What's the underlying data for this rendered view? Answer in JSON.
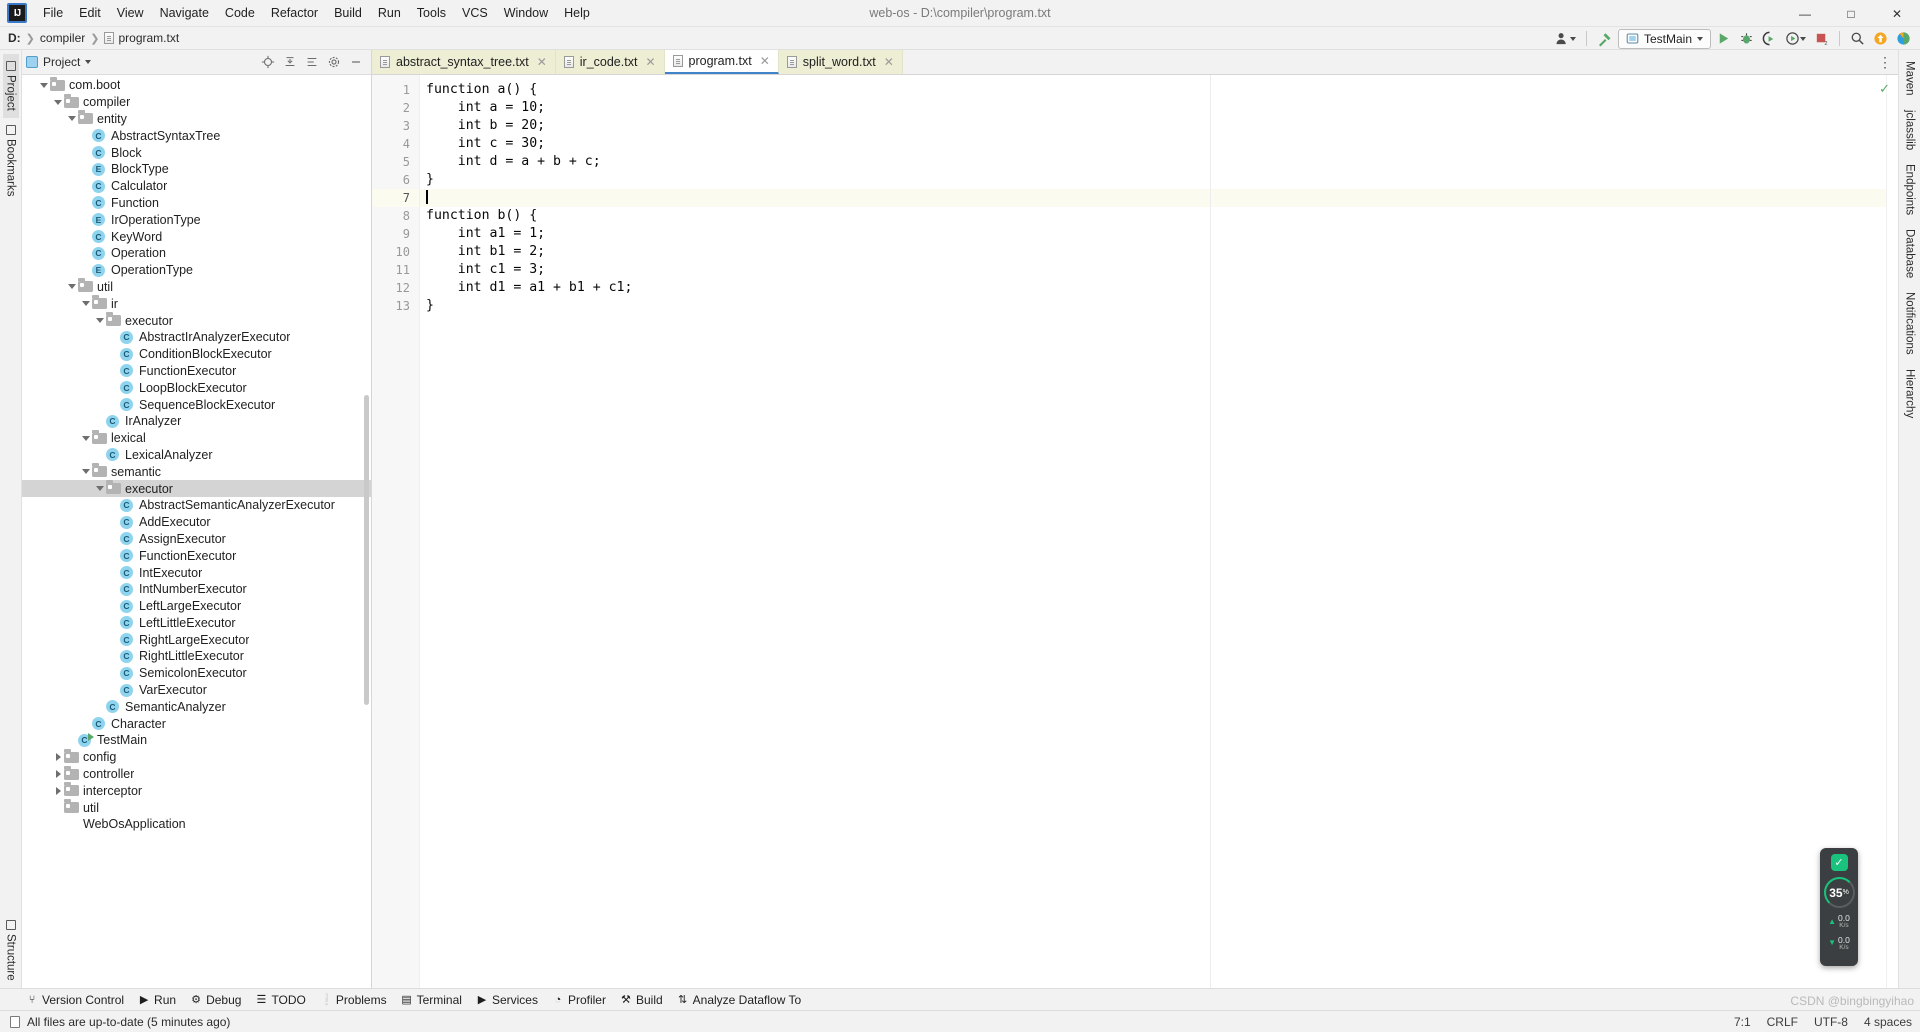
{
  "window": {
    "title": "web-os - D:\\compiler\\program.txt",
    "logo": "IJ",
    "minimize": "—",
    "maximize": "□",
    "close": "✕"
  },
  "menu": [
    "File",
    "Edit",
    "View",
    "Navigate",
    "Code",
    "Refactor",
    "Build",
    "Run",
    "Tools",
    "VCS",
    "Window",
    "Help"
  ],
  "breadcrumb": {
    "drive": "D:",
    "folder": "compiler",
    "file": "program.txt"
  },
  "toolbar": {
    "account_icon": "account-icon",
    "build_icon": "hammer-icon",
    "run_config": "TestMain",
    "run_icon": "run-icon",
    "debug_icon": "debug-icon",
    "run_coverage_icon": "run-with-coverage-icon",
    "profiler_icon": "profiler-icon",
    "stop_icon": "stop-icon",
    "search_icon": "search-icon",
    "update_icon": "update-icon",
    "ide_icon": "ide-icon"
  },
  "left_stripe": [
    {
      "label": "Project",
      "active": true
    },
    {
      "label": "Bookmarks",
      "active": false
    },
    {
      "label": "Structure",
      "active": false
    }
  ],
  "right_stripe": [
    {
      "label": "Maven"
    },
    {
      "label": "jclasslib"
    },
    {
      "label": "Endpoints"
    },
    {
      "label": "Database"
    },
    {
      "label": "Notifications"
    },
    {
      "label": "Hierarchy"
    }
  ],
  "project_panel": {
    "title": "Project",
    "dropdown_icon": "chevron-down-icon",
    "actions": [
      "locate-icon",
      "collapse-all-icon",
      "expand-icon",
      "settings-icon",
      "hide-icon"
    ],
    "tree": [
      {
        "depth": 3,
        "type": "folder",
        "label": "com.boot",
        "twisty": "open"
      },
      {
        "depth": 4,
        "type": "folder",
        "label": "compiler",
        "twisty": "open"
      },
      {
        "depth": 5,
        "type": "folder",
        "label": "entity",
        "twisty": "open"
      },
      {
        "depth": 6,
        "type": "class",
        "label": "AbstractSyntaxTree"
      },
      {
        "depth": 6,
        "type": "class",
        "label": "Block"
      },
      {
        "depth": 6,
        "type": "enum",
        "label": "BlockType"
      },
      {
        "depth": 6,
        "type": "class",
        "label": "Calculator"
      },
      {
        "depth": 6,
        "type": "class",
        "label": "Function"
      },
      {
        "depth": 6,
        "type": "enum",
        "label": "IrOperationType"
      },
      {
        "depth": 6,
        "type": "class",
        "label": "KeyWord"
      },
      {
        "depth": 6,
        "type": "class",
        "label": "Operation"
      },
      {
        "depth": 6,
        "type": "enum",
        "label": "OperationType"
      },
      {
        "depth": 5,
        "type": "folder",
        "label": "util",
        "twisty": "open"
      },
      {
        "depth": 6,
        "type": "folder",
        "label": "ir",
        "twisty": "open"
      },
      {
        "depth": 7,
        "type": "folder",
        "label": "executor",
        "twisty": "open"
      },
      {
        "depth": 8,
        "type": "class",
        "label": "AbstractIrAnalyzerExecutor"
      },
      {
        "depth": 8,
        "type": "class",
        "label": "ConditionBlockExecutor"
      },
      {
        "depth": 8,
        "type": "class",
        "label": "FunctionExecutor"
      },
      {
        "depth": 8,
        "type": "class",
        "label": "LoopBlockExecutor"
      },
      {
        "depth": 8,
        "type": "class",
        "label": "SequenceBlockExecutor"
      },
      {
        "depth": 7,
        "type": "class",
        "label": "IrAnalyzer"
      },
      {
        "depth": 6,
        "type": "folder",
        "label": "lexical",
        "twisty": "open"
      },
      {
        "depth": 7,
        "type": "class",
        "label": "LexicalAnalyzer"
      },
      {
        "depth": 6,
        "type": "folder",
        "label": "semantic",
        "twisty": "open"
      },
      {
        "depth": 7,
        "type": "folder",
        "label": "executor",
        "twisty": "open",
        "selected": true
      },
      {
        "depth": 8,
        "type": "class",
        "label": "AbstractSemanticAnalyzerExecutor"
      },
      {
        "depth": 8,
        "type": "class",
        "label": "AddExecutor"
      },
      {
        "depth": 8,
        "type": "class",
        "label": "AssignExecutor"
      },
      {
        "depth": 8,
        "type": "class",
        "label": "FunctionExecutor"
      },
      {
        "depth": 8,
        "type": "class",
        "label": "IntExecutor"
      },
      {
        "depth": 8,
        "type": "class",
        "label": "IntNumberExecutor"
      },
      {
        "depth": 8,
        "type": "class",
        "label": "LeftLargeExecutor"
      },
      {
        "depth": 8,
        "type": "class",
        "label": "LeftLittleExecutor"
      },
      {
        "depth": 8,
        "type": "class",
        "label": "RightLargeExecutor"
      },
      {
        "depth": 8,
        "type": "class",
        "label": "RightLittleExecutor"
      },
      {
        "depth": 8,
        "type": "class",
        "label": "SemicolonExecutor"
      },
      {
        "depth": 8,
        "type": "class",
        "label": "VarExecutor"
      },
      {
        "depth": 7,
        "type": "class",
        "label": "SemanticAnalyzer"
      },
      {
        "depth": 6,
        "type": "class",
        "label": "Character"
      },
      {
        "depth": 5,
        "type": "class-main",
        "label": "TestMain"
      },
      {
        "depth": 4,
        "type": "folder",
        "label": "config",
        "twisty": "closed"
      },
      {
        "depth": 4,
        "type": "folder",
        "label": "controller",
        "twisty": "closed"
      },
      {
        "depth": 4,
        "type": "folder",
        "label": "interceptor",
        "twisty": "closed"
      },
      {
        "depth": 4,
        "type": "folder",
        "label": "util"
      },
      {
        "depth": 4,
        "type": "spring",
        "label": "WebOsApplication"
      }
    ]
  },
  "editor": {
    "tabs": [
      {
        "label": "abstract_syntax_tree.txt",
        "active": false
      },
      {
        "label": "ir_code.txt",
        "active": false
      },
      {
        "label": "program.txt",
        "active": true
      },
      {
        "label": "split_word.txt",
        "active": false
      }
    ],
    "tab_overflow_icon": "more-options-icon",
    "inspection_icon": "inspection-ok-icon",
    "lines": [
      {
        "n": "1",
        "text": "function a() {"
      },
      {
        "n": "2",
        "text": "    int a = 10;"
      },
      {
        "n": "3",
        "text": "    int b = 20;"
      },
      {
        "n": "4",
        "text": "    int c = 30;"
      },
      {
        "n": "5",
        "text": "    int d = a + b + c;"
      },
      {
        "n": "6",
        "text": "}"
      },
      {
        "n": "7",
        "text": "",
        "current": true
      },
      {
        "n": "8",
        "text": "function b() {"
      },
      {
        "n": "9",
        "text": "    int a1 = 1;"
      },
      {
        "n": "10",
        "text": "    int b1 = 2;"
      },
      {
        "n": "11",
        "text": "    int c1 = 3;"
      },
      {
        "n": "12",
        "text": "    int d1 = a1 + b1 + c1;"
      },
      {
        "n": "13",
        "text": "}"
      }
    ]
  },
  "net_widget": {
    "status_icon": "check-icon",
    "percent": "35",
    "percent_unit": "%",
    "upload_value": "0.0",
    "upload_unit": "K/s",
    "download_value": "0.0",
    "download_unit": "K/s"
  },
  "tool_windows": [
    {
      "label": "Version Control",
      "icon": "branch-icon"
    },
    {
      "label": "Run",
      "icon": "run-icon"
    },
    {
      "label": "Debug",
      "icon": "debug-icon"
    },
    {
      "label": "TODO",
      "icon": "todo-icon"
    },
    {
      "label": "Problems",
      "icon": "problems-icon"
    },
    {
      "label": "Terminal",
      "icon": "terminal-icon"
    },
    {
      "label": "Services",
      "icon": "services-icon"
    },
    {
      "label": "Profiler",
      "icon": "profiler-icon"
    },
    {
      "label": "Build",
      "icon": "hammer-icon"
    },
    {
      "label": "Analyze Dataflow To",
      "icon": "dataflow-icon"
    }
  ],
  "status_bar": {
    "message": "All files are up-to-date (5 minutes ago)",
    "caret_position": "7:1",
    "line_separator": "CRLF",
    "encoding": "UTF-8",
    "indent": "4 spaces",
    "watermark": "CSDN @bingbingyihao"
  }
}
